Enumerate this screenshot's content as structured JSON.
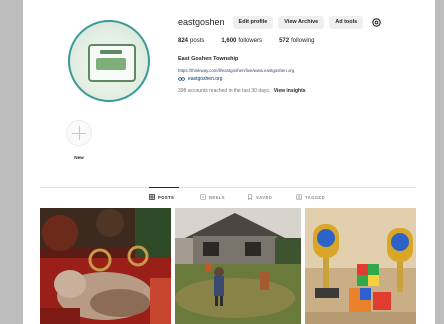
{
  "profile": {
    "username": "eastgoshen",
    "buttons": {
      "edit_profile": "Edit profile",
      "view_archive": "View Archive",
      "ad_tools": "Ad tools"
    },
    "stats": {
      "posts_count": "824",
      "posts_label": "posts",
      "followers_count": "1,600",
      "followers_label": "followers",
      "following_count": "572",
      "following_label": "following"
    },
    "full_name": "East Goshen Township",
    "bio_link": "https://thinkway.com/ll/eastgoshen/live/www.eastgoshen.org",
    "website": "eastgoshen.org",
    "insights_text": "398 accounts reached in the last 30 days.",
    "insights_link": "View insights"
  },
  "highlights": [
    {
      "label": "New"
    }
  ],
  "tabs": [
    {
      "label": "POSTS",
      "icon": "grid-icon",
      "active": true
    },
    {
      "label": "REELS",
      "icon": "reels-icon",
      "active": false
    },
    {
      "label": "SAVED",
      "icon": "bookmark-icon",
      "active": false
    },
    {
      "label": "TAGGED",
      "icon": "tag-icon",
      "active": false
    }
  ],
  "colors": {
    "accent_link": "#00376b",
    "button_bg": "#efefef",
    "avatar_ring": "#3a9a9a"
  }
}
